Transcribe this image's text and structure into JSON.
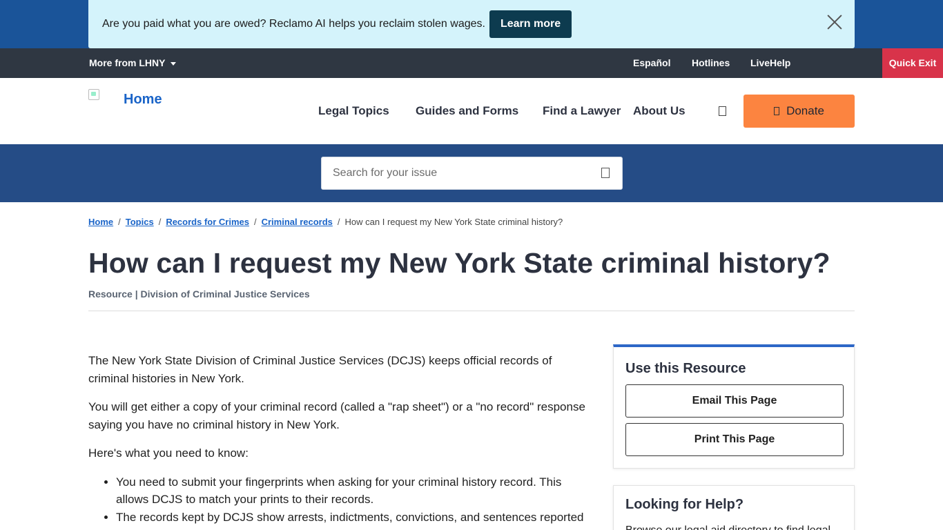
{
  "alert": {
    "text": "Are you paid what you are owed? Reclamo AI helps you reclaim stolen wages.",
    "button": "Learn more"
  },
  "utility": {
    "more_from": "More from LHNY",
    "links": [
      "Español",
      "Hotlines",
      "LiveHelp"
    ],
    "quick_exit": "Quick Exit"
  },
  "header": {
    "home": "Home",
    "nav": [
      "Legal Topics",
      "Guides and Forms",
      "Find a Lawyer",
      "About Us"
    ],
    "donate": "Donate"
  },
  "search": {
    "placeholder": "Search for your issue"
  },
  "breadcrumb": {
    "items": [
      "Home",
      "Topics",
      "Records for Crimes",
      "Criminal records"
    ],
    "current": "How can I request my New York State criminal history?"
  },
  "page": {
    "title": "How can I request my New York State criminal history?",
    "meta": "Resource | Division of Criminal Justice Services",
    "paragraphs": [
      "The New York State Division of Criminal Justice Services (DCJS) keeps official records of criminal histories in New York.",
      "You will get either a copy of your criminal record (called a \"rap sheet\") or a \"no record\" response saying you have no criminal history in New York.",
      "Here's what you need to know:"
    ],
    "bullets": [
      "You need to submit your fingerprints when asking for your criminal history record. This allows DCJS to match your prints to their records.",
      "The records kept by DCJS show arrests, indictments, convictions, and sentences reported"
    ]
  },
  "sidebar": {
    "resource_title": "Use this Resource",
    "email_button": "Email This Page",
    "print_button": "Print This Page",
    "help_title": "Looking for Help?",
    "help_text": "Browse our legal aid directory to find legal"
  },
  "colors": {
    "top_band": "#1a5499",
    "alert_bg": "#d4f3fb",
    "util_bar": "#2f3742",
    "quick_exit": "#d8334a",
    "donate": "#fc8440",
    "search_band": "#254c86",
    "link": "#1a64c8",
    "card_accent": "#2d67c7"
  }
}
